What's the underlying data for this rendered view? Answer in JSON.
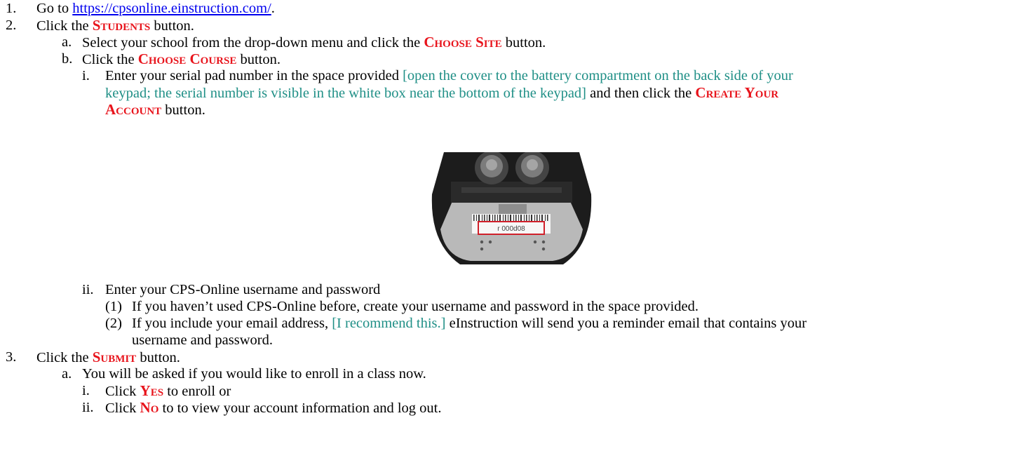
{
  "doc": {
    "step1": {
      "number": "1.",
      "prefix": "Go to ",
      "link": "https://cpsonline.einstruction.com/",
      "suffix": "."
    },
    "step2": {
      "number": "2.",
      "prefix": "Click the ",
      "kw": "Students",
      "suffix": " button."
    },
    "step2a": {
      "number": "a.",
      "prefix": "Select your school from the drop-down menu and click the ",
      "kw": "Choose Site",
      "suffix": " button."
    },
    "step2b": {
      "number": "b.",
      "prefix": "Click the ",
      "kw": "Choose Course",
      "suffix": " button."
    },
    "step2bi": {
      "number": "i.",
      "text1": "Enter your serial pad number in the space provided ",
      "note1": "[open the cover to the battery compartment on the back side of your",
      "note2": "keypad; the serial number is visible in the white box near the bottom of the keypad]",
      "text2": " and then click the ",
      "kw1": "Create Your",
      "kw2": "Account",
      "suffix": " button."
    },
    "photo": {
      "serial_label": "r 000d08"
    },
    "step2bii": {
      "number": "ii.",
      "text": "Enter your CPS-Online username and password"
    },
    "step2bii1": {
      "number": "(1)",
      "text": "If you haven’t used CPS-Online before, create your username and password in the space provided."
    },
    "step2bii2": {
      "number": "(2)",
      "text1": "If you include your email address, ",
      "note": "[I recommend this.]",
      "text2": " eInstruction will send you a reminder email that contains your",
      "text3": "username and password."
    },
    "step3": {
      "number": "3.",
      "prefix": "Click the ",
      "kw": "Submit",
      "suffix": " button."
    },
    "step3a": {
      "number": "a.",
      "text": "You will be asked if you would like to enroll in a class now."
    },
    "step3ai": {
      "number": "i.",
      "prefix": "Click ",
      "kw": "Yes",
      "suffix": " to enroll or"
    },
    "step3aii": {
      "number": "ii.",
      "prefix": "Click ",
      "kw": "No",
      "suffix": " to to view your account information and log out."
    }
  },
  "colors": {
    "keyword": "#e8141c",
    "note": "#1f8f86",
    "link": "#0000ee",
    "highlight_box": "#d0202a"
  },
  "icons": {
    "photo": "keypad-battery-compartment-photo"
  }
}
